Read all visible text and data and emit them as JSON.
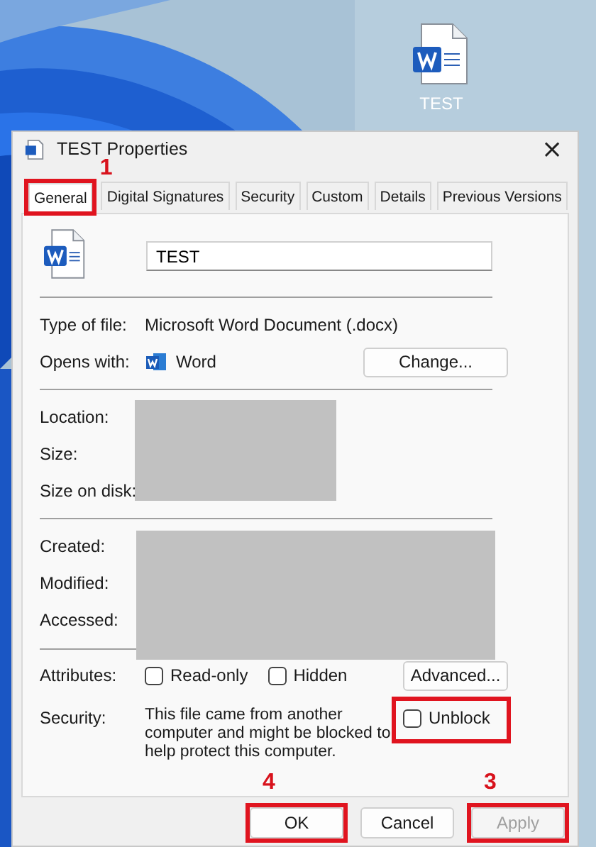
{
  "desktop": {
    "icon_label": "TEST"
  },
  "window": {
    "title": "TEST Properties",
    "close": "×"
  },
  "tabs": [
    {
      "label": "General",
      "selected": true,
      "highlighted": true,
      "step": "1"
    },
    {
      "label": "Digital Signatures",
      "selected": false,
      "highlighted": false
    },
    {
      "label": "Security",
      "selected": false,
      "highlighted": false
    },
    {
      "label": "Custom",
      "selected": false,
      "highlighted": false
    },
    {
      "label": "Details",
      "selected": false,
      "highlighted": false
    },
    {
      "label": "Previous Versions",
      "selected": false,
      "highlighted": false
    }
  ],
  "file_name": {
    "value": "TEST"
  },
  "type_of_file": {
    "label": "Type of file:",
    "value": "Microsoft Word Document (.docx)"
  },
  "opens_with": {
    "label": "Opens with:",
    "app": "Word",
    "button": "Change..."
  },
  "location_labels": [
    "Location:",
    "Size:",
    "Size on disk:"
  ],
  "date_labels": [
    "Created:",
    "Modified:",
    "Accessed:"
  ],
  "attributes": {
    "label": "Attributes:",
    "checkboxes": [
      {
        "label": "Read-only",
        "checked": false
      },
      {
        "label": "Hidden",
        "checked": false
      }
    ],
    "button": "Advanced..."
  },
  "security": {
    "label": "Security:",
    "text": "This file came from another computer and might be blocked to help protect this computer.",
    "unblock": {
      "label": "Unblock",
      "checked": false,
      "highlighted": true
    }
  },
  "buttons": [
    {
      "label": "OK",
      "disabled": false,
      "highlighted": true,
      "step": "4"
    },
    {
      "label": "Cancel",
      "disabled": false,
      "highlighted": false
    },
    {
      "label": "Apply",
      "disabled": true,
      "highlighted": true,
      "step": "3"
    }
  ]
}
